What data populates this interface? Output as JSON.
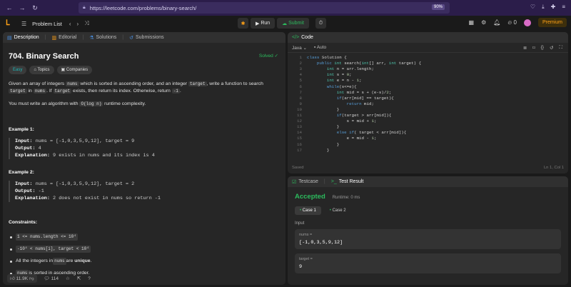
{
  "browser": {
    "url": "https://leetcode.com/problems/binary-search/",
    "zoom": "90%"
  },
  "topbar": {
    "problem_list": "Problem List",
    "run": "Run",
    "submit": "Submit",
    "counter": "0",
    "premium": "Premium"
  },
  "left_tabs": [
    "Description",
    "Editorial",
    "Solutions",
    "Submissions"
  ],
  "problem": {
    "title": "704. Binary Search",
    "solved": "Solved",
    "chips": [
      "Easy",
      "Topics",
      "Companies"
    ],
    "desc1_a": "Given an array of integers ",
    "desc1_code1": "nums",
    "desc1_b": " which is sorted in ascending order, and an integer ",
    "desc1_code2": "target",
    "desc1_c": ", write a function to search ",
    "desc1_code3": "target",
    "desc1_d": " in ",
    "desc1_code4": "nums",
    "desc1_e": ". If ",
    "desc1_code5": "target",
    "desc1_f": " exists, then return its index. Otherwise, return ",
    "desc1_code6": "-1",
    "desc1_g": ".",
    "desc2_a": "You must write an algorithm with ",
    "desc2_code": "O(log n)",
    "desc2_b": " runtime complexity.",
    "ex1_head": "Example 1:",
    "ex1_input_lbl": "Input:",
    "ex1_input": " nums = [-1,0,3,5,9,12], target = 9",
    "ex1_output_lbl": "Output:",
    "ex1_output": " 4",
    "ex1_expl_lbl": "Explanation:",
    "ex1_expl": " 9 exists in nums and its index is 4",
    "ex2_head": "Example 2:",
    "ex2_input_lbl": "Input:",
    "ex2_input": " nums = [-1,0,3,5,9,12], target = 2",
    "ex2_output_lbl": "Output:",
    "ex2_output": " -1",
    "ex2_expl_lbl": "Explanation:",
    "ex2_expl": " 2 does not exist in nums so return -1",
    "constraints_head": "Constraints:",
    "c1": "1 <= nums.length <= 10⁴",
    "c2": "-10⁴ < nums[i], target < 10⁴",
    "c3_a": "All the integers in ",
    "c3_code": "nums",
    "c3_b": " are ",
    "c3_bold": "unique",
    "c3_c": ".",
    "c4_code": "nums",
    "c4_b": " is sorted in ascending order."
  },
  "footer": {
    "likes": "11.9K",
    "comments": "114"
  },
  "code_panel": {
    "tab": "Code",
    "lang": "Java",
    "auto": "Auto",
    "saved": "Saved",
    "cursor": "Ln 1, Col 1",
    "line_numbers": [
      "1",
      "2",
      "3",
      "4",
      "5",
      "6",
      "7",
      "8",
      "9",
      "10",
      "11",
      "12",
      "13",
      "14",
      "15",
      "16",
      "17"
    ],
    "lines": [
      "class Solution {",
      "    public int search(int[] arr, int target) {",
      "        int n = arr.length;",
      "        int s = 0;",
      "        int e = n - 1;",
      "        while(s<=e){",
      "            int mid = s + (e-s)/2;",
      "            if(arr[mid] == target){",
      "                return mid;",
      "            }",
      "            if(target > arr[mid]){",
      "                s = mid + 1;",
      "            }",
      "            else if( target < arr[mid]){",
      "                e = mid - 1;",
      "            }",
      "        }"
    ]
  },
  "result": {
    "tabs": [
      "Testcase",
      "Test Result"
    ],
    "status": "Accepted",
    "runtime": "Runtime: 0 ms",
    "cases": [
      "Case 1",
      "Case 2"
    ],
    "input_label": "Input",
    "var1_name": "nums =",
    "var1_value": "[-1,0,3,5,9,12]",
    "var2_name": "target =",
    "var2_value": "9"
  },
  "colors": {
    "accent": "#ffa116",
    "success": "#2cbb5d",
    "easy": "#1cbaba"
  }
}
